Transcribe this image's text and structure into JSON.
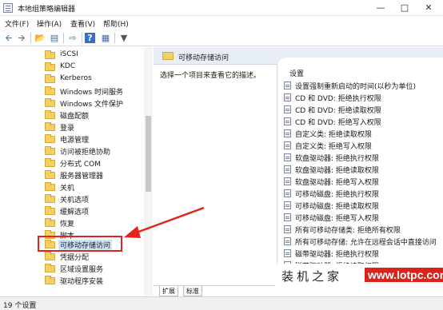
{
  "window": {
    "title": "本地组策略编辑器",
    "minimize_icon": "minimize-icon",
    "maximize_icon": "maximize-icon",
    "close_icon": "close-icon"
  },
  "menu": [
    "文件(F)",
    "操作(A)",
    "查看(V)",
    "帮助(H)"
  ],
  "toolbar_icons": [
    "back-arrow-icon",
    "forward-arrow-icon",
    "up-folder-icon",
    "show-hide-tree-icon",
    "export-list-icon",
    "help-icon",
    "properties-icon",
    "filter-icon"
  ],
  "tree": {
    "items": [
      {
        "label": "iSCSI"
      },
      {
        "label": "KDC"
      },
      {
        "label": "Kerberos"
      },
      {
        "label": "Windows 时间服务"
      },
      {
        "label": "Windows 文件保护"
      },
      {
        "label": "磁盘配额"
      },
      {
        "label": "登录"
      },
      {
        "label": "电源管理"
      },
      {
        "label": "访问被拒绝协助"
      },
      {
        "label": "分布式 COM"
      },
      {
        "label": "服务器管理器"
      },
      {
        "label": "关机"
      },
      {
        "label": "关机选项"
      },
      {
        "label": "缓解选项"
      },
      {
        "label": "恢复"
      },
      {
        "label": "脚本"
      },
      {
        "label": "可移动存储访问"
      },
      {
        "label": "凭据分配"
      },
      {
        "label": "区域设置服务"
      },
      {
        "label": "驱动程序安装"
      }
    ],
    "selected_index": 16
  },
  "content": {
    "header_title": "可移动存储访问",
    "description": "选择一个项目来查看它的描述。",
    "column_header": "设置",
    "policies": [
      "设置强制重新启动的时间(以秒为单位)",
      "CD 和 DVD: 拒绝执行权限",
      "CD 和 DVD: 拒绝读取权限",
      "CD 和 DVD: 拒绝写入权限",
      "自定义类: 拒绝读取权限",
      "自定义类: 拒绝写入权限",
      "软盘驱动器: 拒绝执行权限",
      "软盘驱动器: 拒绝读取权限",
      "软盘驱动器: 拒绝写入权限",
      "可移动磁盘: 拒绝执行权限",
      "可移动磁盘: 拒绝读取权限",
      "可移动磁盘: 拒绝写入权限",
      "所有可移动存储类: 拒绝所有权限",
      "所有可移动存储: 允许在远程会话中直接访问",
      "磁带驱动器: 拒绝执行权限",
      "磁带驱动器: 拒绝读取权限"
    ],
    "tabs": [
      "扩展",
      "标准"
    ]
  },
  "status": {
    "text": "19 个设置"
  },
  "watermark": {
    "chinese": "装机之家",
    "english": "www.lotpc.com"
  },
  "colors": {
    "highlight": "#e3231c",
    "selection": "#cce4f7",
    "folder": "#f3cf6a",
    "header_bg": "#e8eef7",
    "watermark_badge": "#d9231b"
  }
}
